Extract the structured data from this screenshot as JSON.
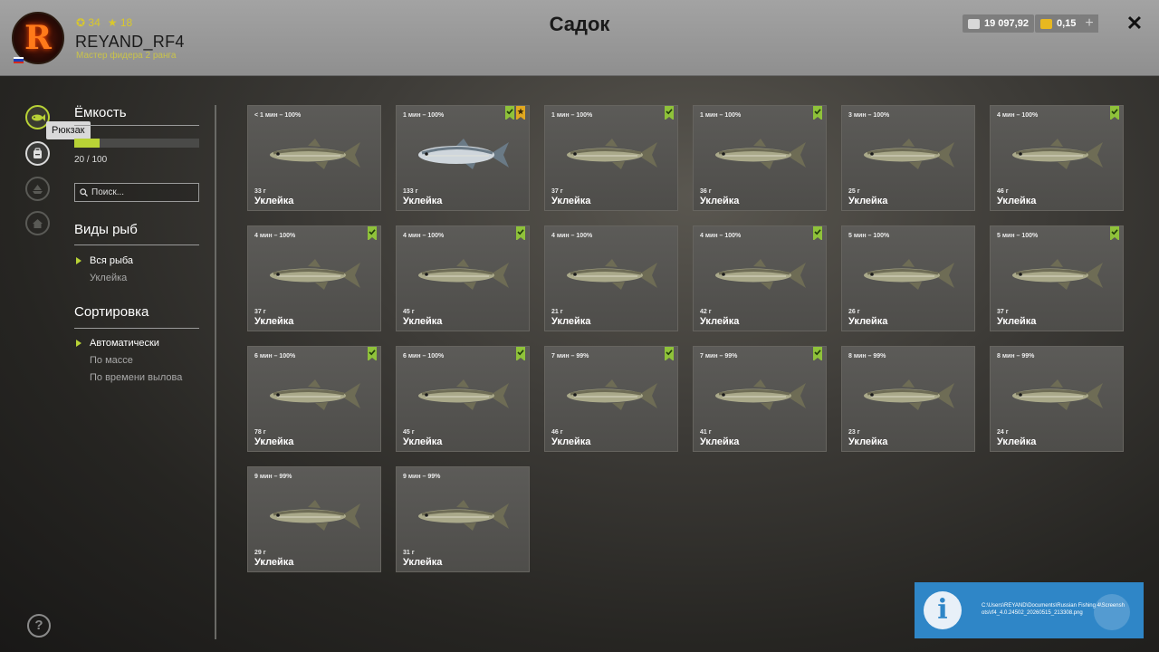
{
  "header": {
    "title": "Садок",
    "player": {
      "avatar_letter": "R",
      "name": "REYAND_RF4",
      "rank": "Мастер фидера 2 ранга",
      "coins": "34",
      "stars": "18",
      "coin_icon": "coin-icon",
      "star_icon": "star-icon"
    },
    "silver": "19 097,92",
    "gold": "0,15",
    "plus_label": "+",
    "close_label": "✕"
  },
  "rail": {
    "tooltip": "Рюкзак",
    "help_label": "?",
    "items": [
      "keepnet-icon",
      "backpack-icon",
      "boat-icon",
      "house-icon"
    ]
  },
  "filters": {
    "capacity": {
      "heading": "Ёмкость",
      "text": "20 / 100",
      "fill_ratio": 0.2
    },
    "search": {
      "placeholder": "Поиск..."
    },
    "species": {
      "heading": "Виды рыб",
      "options": [
        "Вся рыба",
        "Уклейка"
      ],
      "selected": 0
    },
    "sort": {
      "heading": "Сортировка",
      "options": [
        "Автоматически",
        "По массе",
        "По времени вылова"
      ],
      "selected": 0
    }
  },
  "fish": [
    {
      "time": "< 1 мин – 100%",
      "weight": "33 г",
      "name": "Уклейка",
      "badges": [],
      "variant": "bleak"
    },
    {
      "time": "1 мин – 100%",
      "weight": "133 г",
      "name": "Уклейка",
      "badges": [
        "green",
        "gold"
      ],
      "variant": "silver"
    },
    {
      "time": "1 мин – 100%",
      "weight": "37 г",
      "name": "Уклейка",
      "badges": [
        "green"
      ],
      "variant": "bleak"
    },
    {
      "time": "1 мин – 100%",
      "weight": "36 г",
      "name": "Уклейка",
      "badges": [
        "green"
      ],
      "variant": "bleak"
    },
    {
      "time": "3 мин – 100%",
      "weight": "25 г",
      "name": "Уклейка",
      "badges": [],
      "variant": "bleak"
    },
    {
      "time": "4 мин – 100%",
      "weight": "46 г",
      "name": "Уклейка",
      "badges": [
        "green"
      ],
      "variant": "bleak"
    },
    {
      "time": "4 мин – 100%",
      "weight": "37 г",
      "name": "Уклейка",
      "badges": [
        "green"
      ],
      "variant": "bleak"
    },
    {
      "time": "4 мин – 100%",
      "weight": "45 г",
      "name": "Уклейка",
      "badges": [
        "green"
      ],
      "variant": "bleak"
    },
    {
      "time": "4 мин – 100%",
      "weight": "21 г",
      "name": "Уклейка",
      "badges": [],
      "variant": "bleak"
    },
    {
      "time": "4 мин – 100%",
      "weight": "42 г",
      "name": "Уклейка",
      "badges": [
        "green"
      ],
      "variant": "bleak"
    },
    {
      "time": "5 мин – 100%",
      "weight": "26 г",
      "name": "Уклейка",
      "badges": [],
      "variant": "bleak"
    },
    {
      "time": "5 мин – 100%",
      "weight": "37 г",
      "name": "Уклейка",
      "badges": [
        "green"
      ],
      "variant": "bleak"
    },
    {
      "time": "6 мин – 100%",
      "weight": "78 г",
      "name": "Уклейка",
      "badges": [
        "green"
      ],
      "variant": "bleak"
    },
    {
      "time": "6 мин – 100%",
      "weight": "45 г",
      "name": "Уклейка",
      "badges": [
        "green"
      ],
      "variant": "bleak"
    },
    {
      "time": "7 мин – 99%",
      "weight": "46 г",
      "name": "Уклейка",
      "badges": [
        "green"
      ],
      "variant": "bleak"
    },
    {
      "time": "7 мин – 99%",
      "weight": "41 г",
      "name": "Уклейка",
      "badges": [
        "green"
      ],
      "variant": "bleak"
    },
    {
      "time": "8 мин – 99%",
      "weight": "23 г",
      "name": "Уклейка",
      "badges": [],
      "variant": "bleak"
    },
    {
      "time": "8 мин – 99%",
      "weight": "24 г",
      "name": "Уклейка",
      "badges": [],
      "variant": "bleak"
    },
    {
      "time": "9 мин – 99%",
      "weight": "29 г",
      "name": "Уклейка",
      "badges": [],
      "variant": "bleak"
    },
    {
      "time": "9 мин – 99%",
      "weight": "31 г",
      "name": "Уклейка",
      "badges": [],
      "variant": "bleak"
    }
  ],
  "notification": {
    "icon_label": "i",
    "path": "C:\\Users\\REYAND\\Documents\\Russian Fishing 4\\Screenshots\\rf4_4.0.24502_20260515_213308.png"
  },
  "colors": {
    "accent": "#b8d236",
    "badge_green": "#8fc23a",
    "badge_gold": "#e0a820",
    "notify_blue": "#2f86c7"
  }
}
